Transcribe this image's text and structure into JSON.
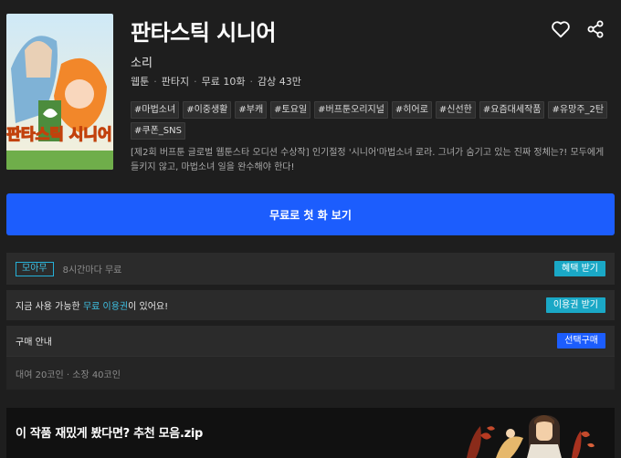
{
  "title": "판타스틱 시니어",
  "author": "소리",
  "meta": [
    "웹툰",
    "판타지",
    "무료 10화",
    "감상 43만"
  ],
  "tags": [
    "#마법소녀",
    "#이중생활",
    "#부캐",
    "#토요일",
    "#버프툰오리지널",
    "#히어로",
    "#신선한",
    "#요즘대세작품",
    "#유망주_2탄",
    "#쿠폰_SNS"
  ],
  "description": "[제2회 버프툰 글로벌 웹툰스타 오디션 수상작] 인기절정 '시니어'마법소녀 로라. 그녀가 숨기고 있는 진짜 정체는?! 모두에게 들키지 않고, 마법소녀 일을 완수해야 한다!",
  "cover_text": "판타스틱 시니어",
  "cta_label": "무료로 첫 화 보기",
  "free_row": {
    "badge": "모아무",
    "text": "8시간마다 무료",
    "button": "혜택 받기"
  },
  "ticket_row": {
    "prefix": "지금 사용 가능한 ",
    "highlight": "무료 이용권",
    "suffix": "이 있어요!",
    "button": "이용권 받기"
  },
  "purchase_row": {
    "label": "구매 안내",
    "button": "선택구매"
  },
  "price_row": {
    "text": "대여 20코인 · 소장 40코인"
  },
  "banner": {
    "text": "이 작품 재밌게 봤다면? 추천 모음.zip"
  },
  "colors": {
    "accent_blue": "#1c5dfd",
    "accent_teal": "#1aa8c6",
    "background": "#1e1e1e"
  },
  "icons": {
    "like": "heart-icon",
    "share": "share-icon"
  }
}
